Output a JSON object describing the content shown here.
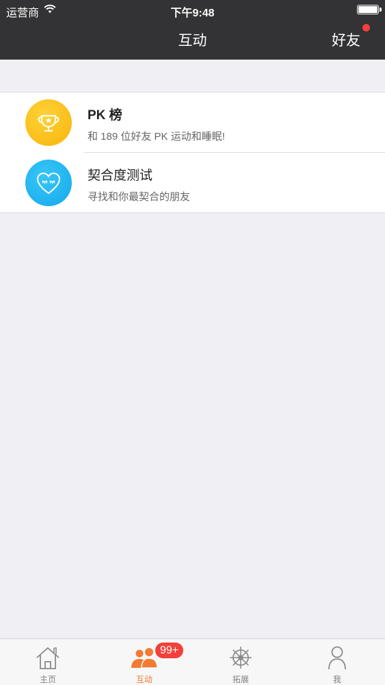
{
  "status_bar": {
    "carrier": "运营商",
    "time": "下午9:48"
  },
  "nav": {
    "title": "互动",
    "right_label": "好友"
  },
  "list": {
    "items": [
      {
        "title": "PK 榜",
        "subtitle": "和 189 位好友 PK 运动和睡眠!",
        "icon": "trophy-icon",
        "color": "#f8b40a"
      },
      {
        "title": "契合度测试",
        "subtitle": "寻找和你最契合的朋友",
        "icon": "heart-icon",
        "color": "#14a9ec"
      }
    ]
  },
  "tabbar": {
    "tabs": [
      {
        "label": "主页",
        "icon": "home-icon"
      },
      {
        "label": "互动",
        "icon": "people-icon",
        "badge": "99+",
        "active": true
      },
      {
        "label": "拓展",
        "icon": "ship-wheel-icon"
      },
      {
        "label": "我",
        "icon": "person-icon"
      }
    ]
  },
  "colors": {
    "nav_bg": "#333335",
    "accent": "#f27a33",
    "badge": "#f2403a",
    "page_bg": "#efeff4"
  }
}
